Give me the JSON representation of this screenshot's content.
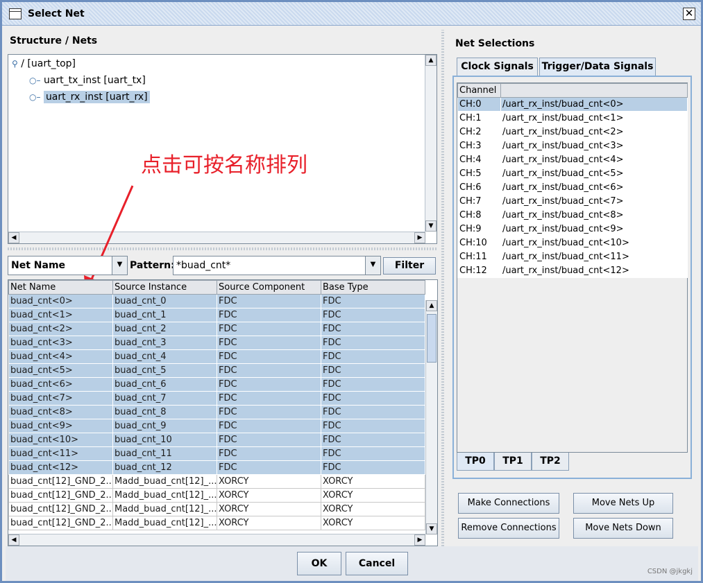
{
  "window": {
    "title": "Select Net"
  },
  "structure": {
    "title": "Structure / Nets",
    "tree": [
      {
        "label": "/ [uart_top]"
      },
      {
        "label": "uart_tx_inst [uart_tx]"
      },
      {
        "label": "uart_rx_inst [uart_rx]"
      }
    ]
  },
  "annotation": "点击可按名称排列",
  "filter": {
    "column": "Net Name",
    "pattern_label": "Pattern:",
    "pattern_value": "*buad_cnt*",
    "button": "Filter"
  },
  "nets_table": {
    "columns": [
      "Net Name",
      "Source Instance",
      "Source Component",
      "Base Type"
    ],
    "rows": [
      [
        "buad_cnt<0>",
        "buad_cnt_0",
        "FDC",
        "FDC"
      ],
      [
        "buad_cnt<1>",
        "buad_cnt_1",
        "FDC",
        "FDC"
      ],
      [
        "buad_cnt<2>",
        "buad_cnt_2",
        "FDC",
        "FDC"
      ],
      [
        "buad_cnt<3>",
        "buad_cnt_3",
        "FDC",
        "FDC"
      ],
      [
        "buad_cnt<4>",
        "buad_cnt_4",
        "FDC",
        "FDC"
      ],
      [
        "buad_cnt<5>",
        "buad_cnt_5",
        "FDC",
        "FDC"
      ],
      [
        "buad_cnt<6>",
        "buad_cnt_6",
        "FDC",
        "FDC"
      ],
      [
        "buad_cnt<7>",
        "buad_cnt_7",
        "FDC",
        "FDC"
      ],
      [
        "buad_cnt<8>",
        "buad_cnt_8",
        "FDC",
        "FDC"
      ],
      [
        "buad_cnt<9>",
        "buad_cnt_9",
        "FDC",
        "FDC"
      ],
      [
        "buad_cnt<10>",
        "buad_cnt_10",
        "FDC",
        "FDC"
      ],
      [
        "buad_cnt<11>",
        "buad_cnt_11",
        "FDC",
        "FDC"
      ],
      [
        "buad_cnt<12>",
        "buad_cnt_12",
        "FDC",
        "FDC"
      ],
      [
        "buad_cnt[12]_GND_2...",
        "Madd_buad_cnt[12]_...",
        "XORCY",
        "XORCY"
      ],
      [
        "buad_cnt[12]_GND_2...",
        "Madd_buad_cnt[12]_...",
        "XORCY",
        "XORCY"
      ],
      [
        "buad_cnt[12]_GND_2...",
        "Madd_buad_cnt[12]_...",
        "XORCY",
        "XORCY"
      ],
      [
        "buad_cnt[12]_GND_2...",
        "Madd_buad_cnt[12]_...",
        "XORCY",
        "XORCY"
      ]
    ]
  },
  "net_selections": {
    "title": "Net Selections",
    "tabs": [
      "Clock Signals",
      "Trigger/Data Signals"
    ],
    "channel_header": "Channel",
    "channels": [
      [
        "CH:0",
        "/uart_rx_inst/buad_cnt<0>"
      ],
      [
        "CH:1",
        "/uart_rx_inst/buad_cnt<1>"
      ],
      [
        "CH:2",
        "/uart_rx_inst/buad_cnt<2>"
      ],
      [
        "CH:3",
        "/uart_rx_inst/buad_cnt<3>"
      ],
      [
        "CH:4",
        "/uart_rx_inst/buad_cnt<4>"
      ],
      [
        "CH:5",
        "/uart_rx_inst/buad_cnt<5>"
      ],
      [
        "CH:6",
        "/uart_rx_inst/buad_cnt<6>"
      ],
      [
        "CH:7",
        "/uart_rx_inst/buad_cnt<7>"
      ],
      [
        "CH:8",
        "/uart_rx_inst/buad_cnt<8>"
      ],
      [
        "CH:9",
        "/uart_rx_inst/buad_cnt<9>"
      ],
      [
        "CH:10",
        "/uart_rx_inst/buad_cnt<10>"
      ],
      [
        "CH:11",
        "/uart_rx_inst/buad_cnt<11>"
      ],
      [
        "CH:12",
        "/uart_rx_inst/buad_cnt<12>"
      ]
    ],
    "bottom_tabs": [
      "TP0",
      "TP1",
      "TP2"
    ],
    "buttons": {
      "make": "Make Connections",
      "remove": "Remove Connections",
      "up": "Move Nets Up",
      "down": "Move Nets Down"
    }
  },
  "footer": {
    "ok": "OK",
    "cancel": "Cancel"
  },
  "watermark": "CSDN @jkgkj"
}
